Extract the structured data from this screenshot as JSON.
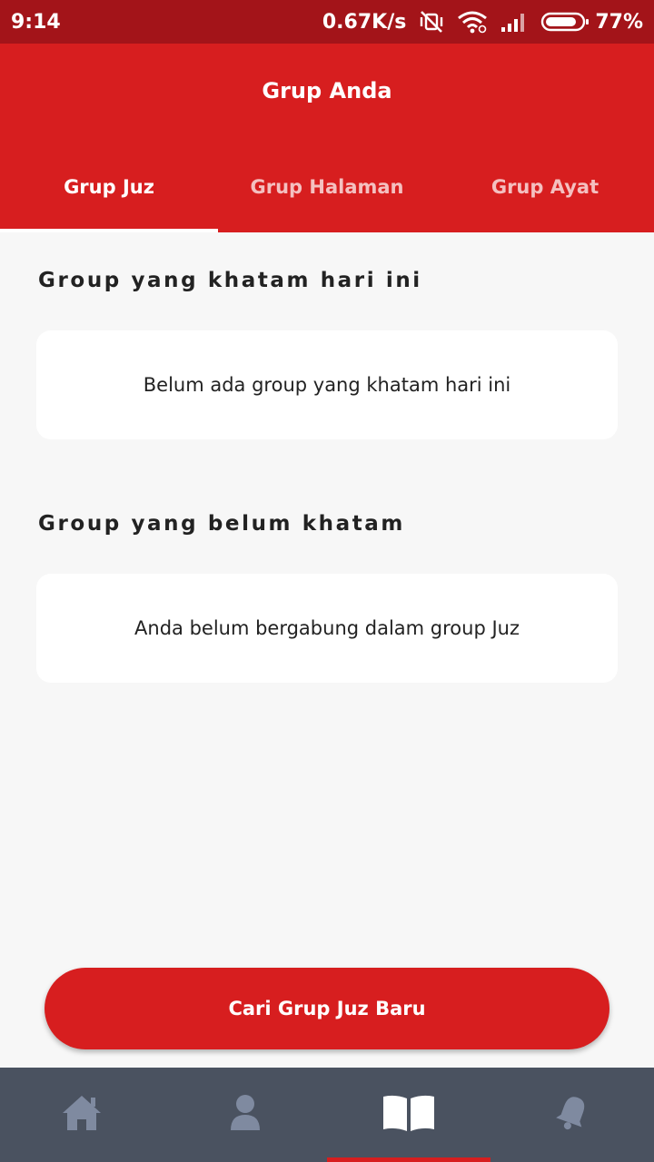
{
  "status_bar": {
    "time": "9:14",
    "speed": "0.67K/s",
    "battery": "77%",
    "icons": [
      "mute-vibrate-icon",
      "wifi-icon",
      "signal-icon",
      "battery-icon"
    ]
  },
  "header": {
    "title": "Grup Anda"
  },
  "tabs": [
    {
      "label": "Grup Juz",
      "active": true
    },
    {
      "label": "Grup Halaman",
      "active": false
    },
    {
      "label": "Grup Ayat",
      "active": false
    }
  ],
  "sections": [
    {
      "title": "Group yang khatam hari ini",
      "message": "Belum ada group yang khatam hari ini"
    },
    {
      "title": "Group yang belum khatam",
      "message": "Anda belum bergabung dalam group Juz"
    }
  ],
  "cta": {
    "label": "Cari Grup Juz Baru"
  },
  "bottom_nav": {
    "items": [
      {
        "icon": "home-icon",
        "active": false
      },
      {
        "icon": "profile-icon",
        "active": false
      },
      {
        "icon": "book-icon",
        "active": true
      },
      {
        "icon": "bell-icon",
        "active": false
      }
    ]
  },
  "colors": {
    "primary": "#d71e1f",
    "status_bar": "#a31419",
    "nav_background": "#4a5260",
    "nav_icon": "#7f8aa0",
    "background": "#f7f7f7"
  }
}
